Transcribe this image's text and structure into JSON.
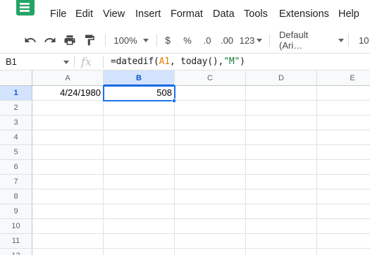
{
  "menu": {
    "items": [
      "File",
      "Edit",
      "View",
      "Insert",
      "Format",
      "Data",
      "Tools",
      "Extensions",
      "Help"
    ]
  },
  "toolbar": {
    "zoom": "100%",
    "currency": "$",
    "percent": "%",
    "decrease_decimal": ".0",
    "increase_decimal": ".00",
    "number_format": "123",
    "font": "Default (Ari…",
    "font_size": "10"
  },
  "formula_bar": {
    "name_box": "B1",
    "fx": "fx",
    "formula_prefix": "=datedif(",
    "formula_ref": "A1",
    "formula_mid": ", today(),",
    "formula_string": "\"M\"",
    "formula_suffix": ")"
  },
  "grid": {
    "columns": [
      "A",
      "B",
      "C",
      "D",
      "E"
    ],
    "selected_column": "B",
    "rows": [
      "1",
      "2",
      "3",
      "4",
      "5",
      "6",
      "7",
      "8",
      "9",
      "10",
      "11",
      "12"
    ],
    "selected_row": "1",
    "cells": {
      "A1": "4/24/1980",
      "B1": "508"
    }
  },
  "colors": {
    "logo": "#23a566",
    "selection": "#1a73e8",
    "formula_ref": "#e67c00",
    "formula_string": "#188038"
  }
}
